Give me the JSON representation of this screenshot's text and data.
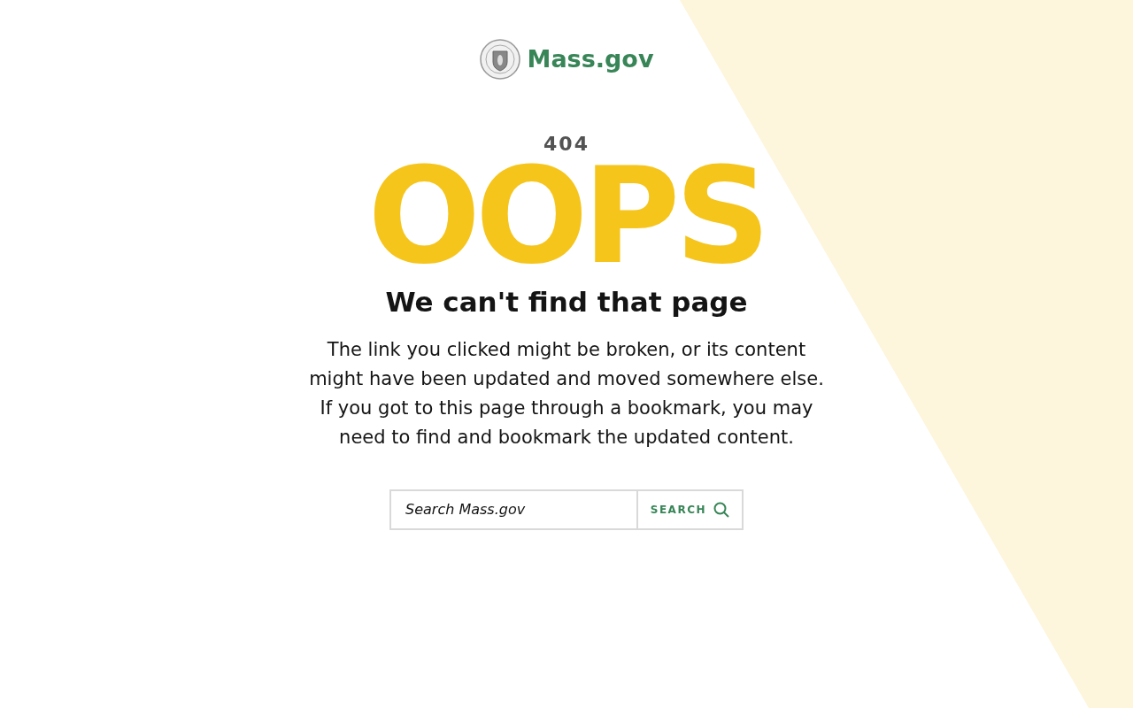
{
  "logo": {
    "text": "Mass.gov"
  },
  "error_code": "404",
  "headline": "OOPS",
  "title": "We can't find that page",
  "message": "The link you clicked might be broken, or its content might have been updated and moved somewhere else. If you got to this page through a bookmark, you may need to find and bookmark the updated content.",
  "search": {
    "placeholder": "Search Mass.gov",
    "button": "SEARCH"
  }
}
